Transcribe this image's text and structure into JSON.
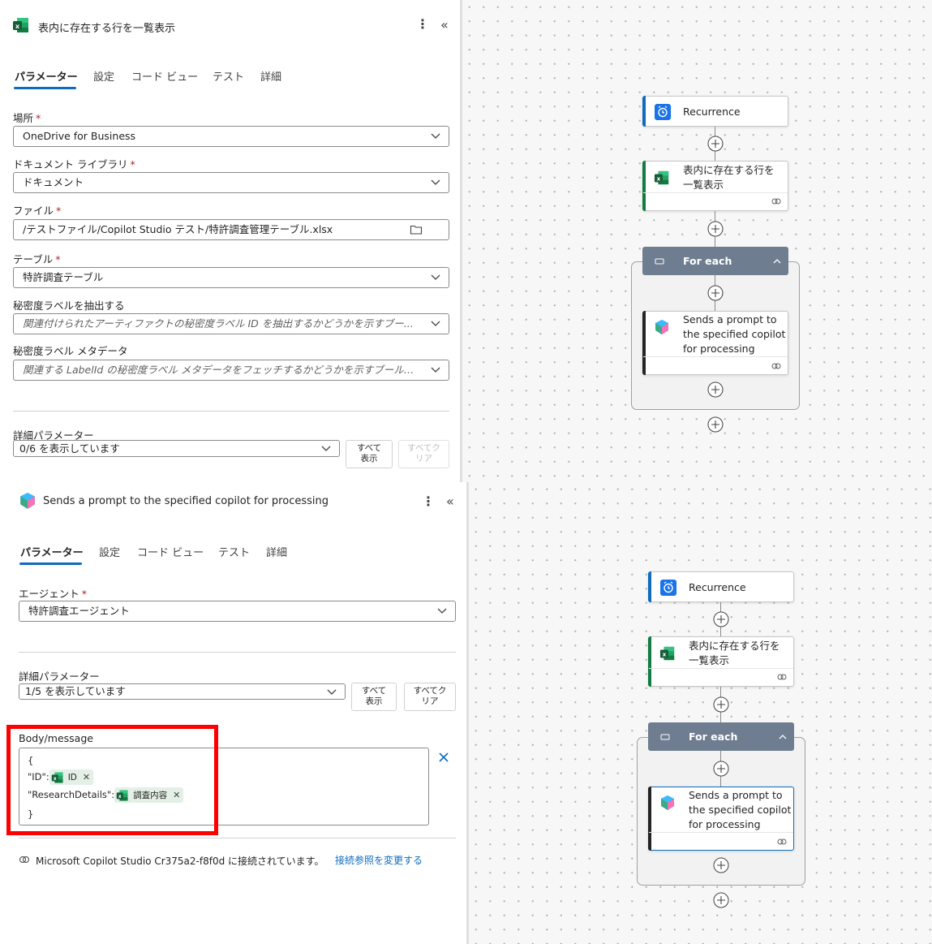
{
  "top_panel": {
    "title": "表内に存在する行を一覧表示",
    "tabs": [
      "パラメーター",
      "設定",
      "コード ビュー",
      "テスト",
      "詳細"
    ],
    "fields": {
      "location": {
        "label": "場所",
        "value": "OneDrive for Business"
      },
      "library": {
        "label": "ドキュメント ライブラリ",
        "value": "ドキュメント"
      },
      "file": {
        "label": "ファイル",
        "value": "/テストファイル/Copilot Studio テスト/特許調査管理テーブル.xlsx"
      },
      "table": {
        "label": "テーブル",
        "value": "特許調査テーブル"
      },
      "sensitivity": {
        "label": "秘密度ラベルを抽出する",
        "placeholder": "関連付けられたアーティファクトの秘密度ラベル ID を抽出するかどうかを示すブー..."
      },
      "sensitivity_meta": {
        "label": "秘密度ラベル メタデータ",
        "placeholder": "関連する LabelId の秘密度ラベル メタデータをフェッチするかどうかを示すブール値..."
      }
    },
    "advanced": {
      "label": "詳細パラメーター",
      "value": "0/6 を表示しています",
      "show_all": "すべて\n表示",
      "clear_all": "すべてク\nリア"
    }
  },
  "bottom_panel": {
    "title": "Sends a prompt to the specified copilot for processing",
    "tabs": [
      "パラメーター",
      "設定",
      "コード ビュー",
      "テスト",
      "詳細"
    ],
    "agent": {
      "label": "エージェント",
      "value": "特許調査エージェント"
    },
    "advanced": {
      "label": "詳細パラメーター",
      "value": "1/5 を表示しています",
      "show_all": "すべて\n表示",
      "clear_all": "すべてク\nリア"
    },
    "body": {
      "label": "Body/message",
      "open": "{",
      "id_key": "\"ID\":",
      "id_token": "ID",
      "research_key": "\"ResearchDetails\":",
      "research_token": "調査内容",
      "close": "}"
    },
    "connection": {
      "text": "Microsoft Copilot Studio Cr375a2-f8f0d に接続されています。",
      "link": "接続参照を変更する"
    }
  },
  "flow": {
    "recurrence": "Recurrence",
    "list_rows_line1": "表内に存在する行を",
    "list_rows_line2": "一覧表示",
    "foreach": "For each",
    "copilot_line1": "Sends a prompt to",
    "copilot_line2": "the specified copilot",
    "copilot_line3": "for processing"
  },
  "colors": {
    "accent": "#0f6cbd",
    "excel": "#107c41",
    "highlight": "#ff0000",
    "foreach": "#6e7d8f"
  }
}
